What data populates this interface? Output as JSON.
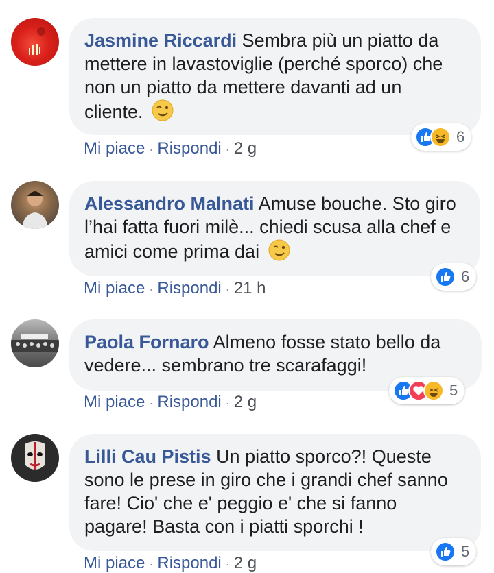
{
  "comments": [
    {
      "author": "Jasmine Riccardi",
      "text": "Sembra più un piatto da mettere in lavastoviglie (perché sporco) che non un piatto da mettere davanti ad un cliente.",
      "emoji": "wink-emoji",
      "like_label": "Mi piace",
      "reply_label": "Rispondi",
      "time": "2 g",
      "reaction_icons": [
        "like",
        "haha"
      ],
      "reaction_count": "6"
    },
    {
      "author": "Alessandro Malnati",
      "text": "Amuse bouche. Sto giro l’hai fatta fuori milè... chiedi scusa alla chef e amici come prima dai",
      "emoji": "wink-emoji",
      "like_label": "Mi piace",
      "reply_label": "Rispondi",
      "time": "21 h",
      "reaction_icons": [
        "like"
      ],
      "reaction_count": "6"
    },
    {
      "author": "Paola Fornaro",
      "text": "Almeno fosse stato bello da vedere... sembrano tre scarafaggi!",
      "like_label": "Mi piace",
      "reply_label": "Rispondi",
      "time": "2 g",
      "reaction_icons": [
        "like",
        "love",
        "haha"
      ],
      "reaction_count": "5"
    },
    {
      "author": "Lilli Cau Pistis",
      "text": "Un piatto sporco?! Queste sono le prese in giro che i grandi chef sanno fare! Cio' che e' peggio e' che si fanno pagare! Basta con i piatti sporchi !",
      "like_label": "Mi piace",
      "reply_label": "Rispondi",
      "time": "2 g",
      "reaction_icons": [
        "like"
      ],
      "reaction_count": "5"
    }
  ],
  "separator": "·",
  "colors": {
    "link": "#385898",
    "bubble": "#f2f3f5",
    "like": "#1877f2",
    "love": "#f33e58",
    "haha": "#f7b928"
  }
}
